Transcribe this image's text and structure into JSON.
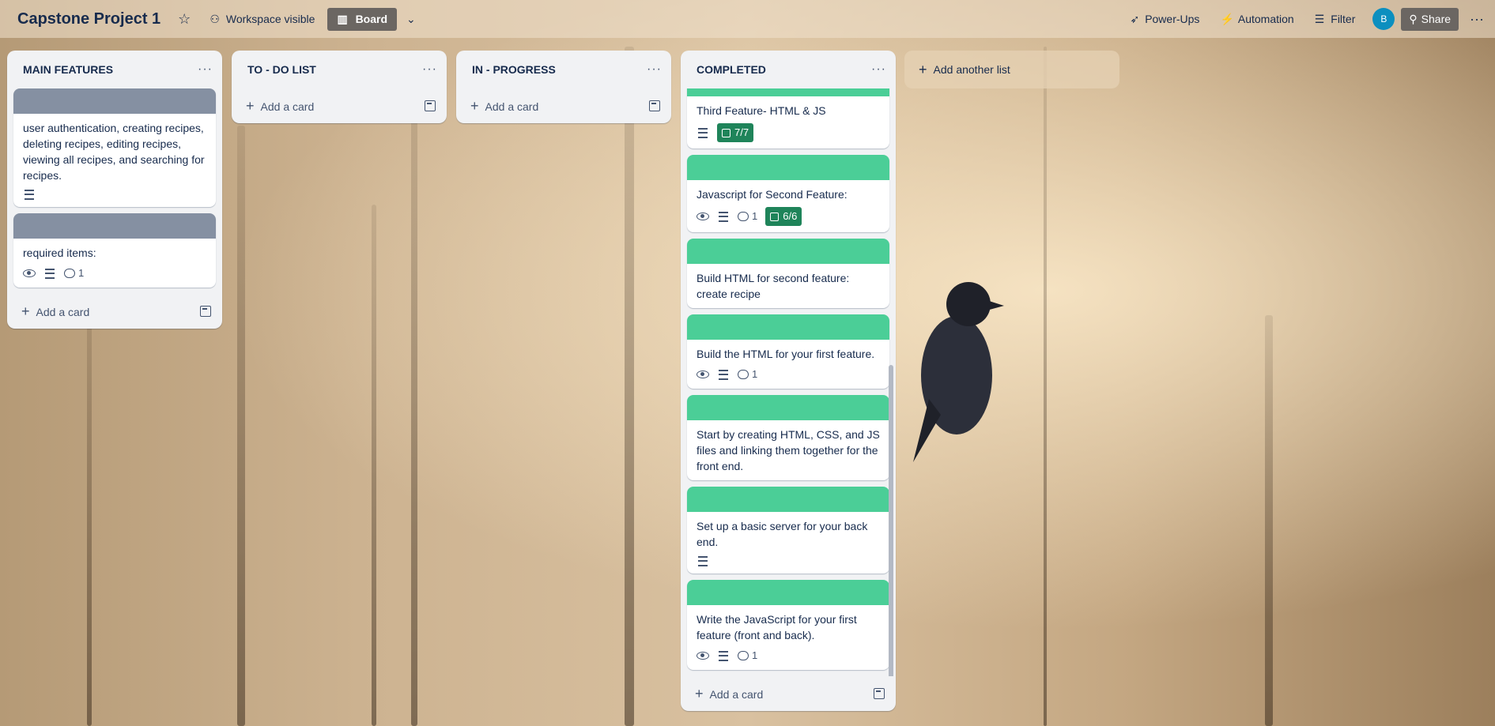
{
  "header": {
    "board_title": "Capstone Project 1",
    "visibility_label": "Workspace visible",
    "board_view_label": "Board",
    "powerups_label": "Power-Ups",
    "automation_label": "Automation",
    "filter_label": "Filter",
    "avatar_initial": "B",
    "share_label": "Share"
  },
  "lists": [
    {
      "title": "MAIN FEATURES",
      "cards": [
        {
          "cover": "gray",
          "text": "user authentication, creating recipes, deleting recipes, editing recipes, viewing all recipes, and searching for recipes."
        },
        {
          "cover": "gray",
          "text": "required items:",
          "comments": "1"
        }
      ],
      "add_label": "Add a card"
    },
    {
      "title": "TO - DO LIST",
      "add_label": "Add a card"
    },
    {
      "title": "IN - PROGRESS",
      "add_label": "Add a card"
    },
    {
      "title": "COMPLETED",
      "cards": [
        {
          "cover": "green",
          "text": "Third Feature- HTML & JS",
          "checklist": "7/7"
        },
        {
          "cover": "green",
          "text": "Javascript for Second Feature:",
          "comments": "1",
          "checklist": "6/6"
        },
        {
          "cover": "green",
          "text": "Build HTML for second feature: create recipe"
        },
        {
          "cover": "green",
          "text": "Build the HTML for your first feature.",
          "comments": "1"
        },
        {
          "cover": "green",
          "text": "Start by creating HTML, CSS, and JS files and linking them together for the front end."
        },
        {
          "cover": "green",
          "text": "Set up a basic server for your back end."
        },
        {
          "cover": "green",
          "text": "Write the JavaScript for your first feature (front and back).",
          "comments": "1"
        }
      ],
      "add_label": "Add a card"
    }
  ],
  "add_another_list_label": "Add another list",
  "colors": {
    "label_green": "#4bce97",
    "label_gray": "#8590a2",
    "checklist_complete": "#1f845a",
    "avatar": "#0c8fbf"
  }
}
